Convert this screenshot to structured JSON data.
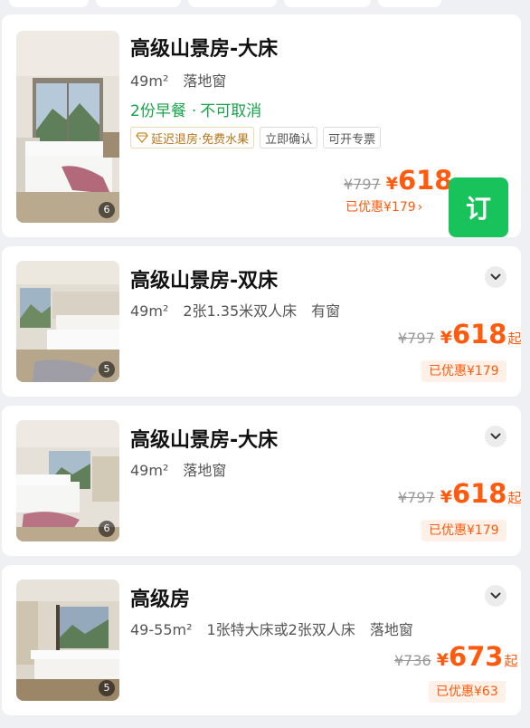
{
  "rooms": [
    {
      "name": "高级山景房-大床",
      "area": "49m²",
      "bed": "",
      "window": "落地窗",
      "meal": "2份早餐",
      "cancel": "不可取消",
      "tags": [
        "延迟退房·免费水果",
        "立即确认",
        "可开专票"
      ],
      "old_price": "¥797",
      "currency": "¥",
      "price": "618",
      "suffix": "",
      "discount": "已优惠¥179",
      "photo_count": "6",
      "book_label": "订",
      "discount_arrow": "›"
    },
    {
      "name": "高级山景房-双床",
      "area": "49m²",
      "bed": "2张1.35米双人床",
      "window": "有窗",
      "old_price": "¥797",
      "currency": "¥",
      "price": "618",
      "suffix": "起",
      "discount": "已优惠¥179",
      "photo_count": "5"
    },
    {
      "name": "高级山景房-大床",
      "area": "49m²",
      "window": "落地窗",
      "old_price": "¥797",
      "currency": "¥",
      "price": "618",
      "suffix": "起",
      "discount": "已优惠¥179",
      "photo_count": "6"
    },
    {
      "name": "高级房",
      "area": "49-55m²",
      "bed": "1张特大床或2张双人床",
      "window": "落地窗",
      "old_price": "¥736",
      "currency": "¥",
      "price": "673",
      "suffix": "起",
      "discount": "已优惠¥63",
      "photo_count": "5"
    }
  ],
  "colors": {
    "accent_orange": "#ff5a0e",
    "book_green": "#19c35b",
    "meal_green": "#17a34a",
    "page_bg": "#eef0f3"
  },
  "icons": [
    "diamond-icon",
    "chevron-down-icon",
    "chevron-right-icon"
  ]
}
